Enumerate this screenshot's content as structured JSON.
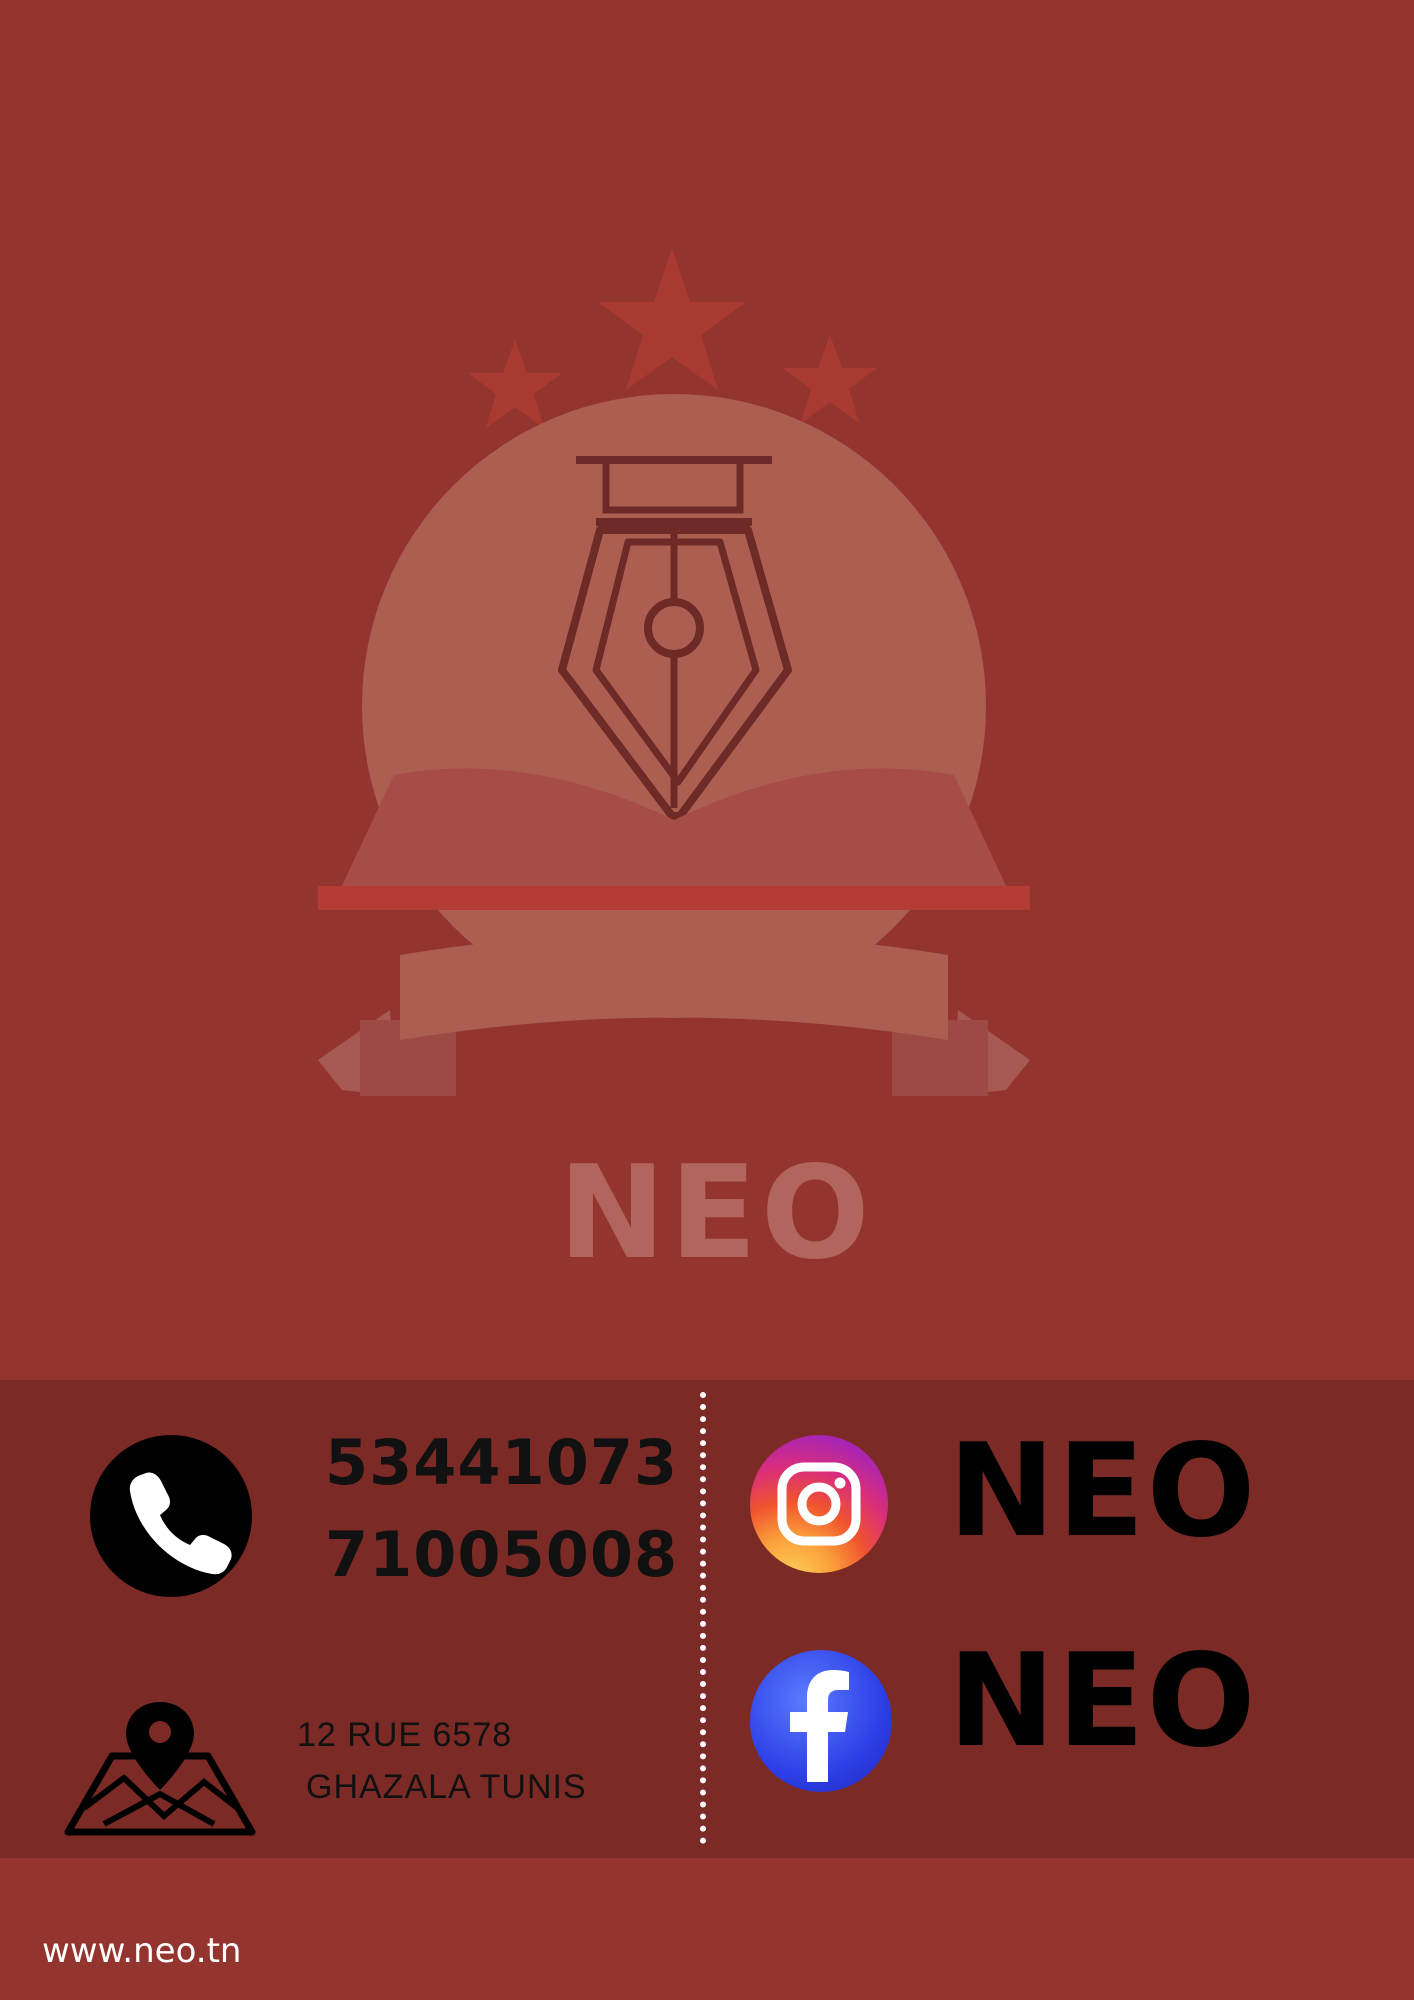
{
  "logo": {
    "wordmark": "NEO",
    "icon": "pen-nib-graduation-cap-open-book-logo"
  },
  "contact": {
    "phone_icon": "phone-icon",
    "phones": [
      "53441073",
      "71005008"
    ],
    "address_icon": "map-pin-icon",
    "address": [
      "12 RUE 6578",
      "GHAZALA TUNIS"
    ]
  },
  "social": {
    "instagram": {
      "icon": "instagram-icon",
      "name": "NEO"
    },
    "facebook": {
      "icon": "facebook-icon",
      "name": "NEO"
    }
  },
  "footer": {
    "website": "www.neo.tn"
  },
  "colors": {
    "background": "#93352e",
    "panel": "#7c2a25",
    "logo_tint": "#b2655c",
    "text_dark": "#111111",
    "text_light": "#ffffff"
  }
}
